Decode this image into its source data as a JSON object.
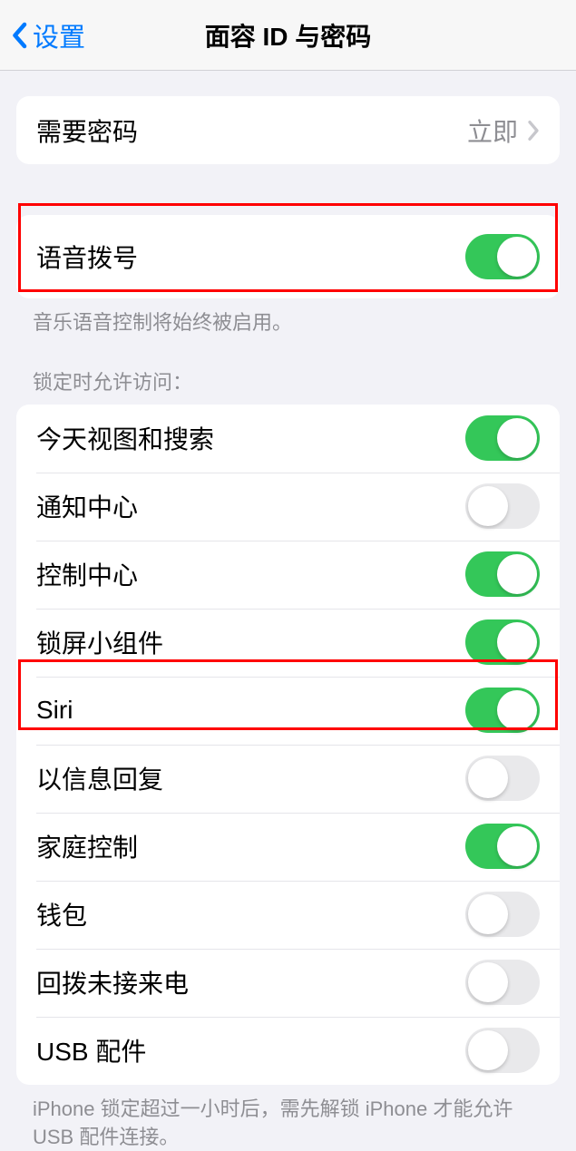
{
  "nav": {
    "back_label": "设置",
    "title": "面容 ID 与密码"
  },
  "require_passcode": {
    "label": "需要密码",
    "value": "立即"
  },
  "voice_dial": {
    "label": "语音拨号",
    "on": true,
    "footer": "音乐语音控制将始终被启用。"
  },
  "locked_access": {
    "header": "锁定时允许访问：",
    "items": [
      {
        "label": "今天视图和搜索",
        "on": true
      },
      {
        "label": "通知中心",
        "on": false
      },
      {
        "label": "控制中心",
        "on": true
      },
      {
        "label": "锁屏小组件",
        "on": true
      },
      {
        "label": "Siri",
        "on": true
      },
      {
        "label": "以信息回复",
        "on": false
      },
      {
        "label": "家庭控制",
        "on": true
      },
      {
        "label": "钱包",
        "on": false
      },
      {
        "label": "回拨未接来电",
        "on": false
      },
      {
        "label": "USB 配件",
        "on": false
      }
    ],
    "footer": "iPhone 锁定超过一小时后，需先解锁 iPhone 才能允许USB 配件连接。"
  }
}
